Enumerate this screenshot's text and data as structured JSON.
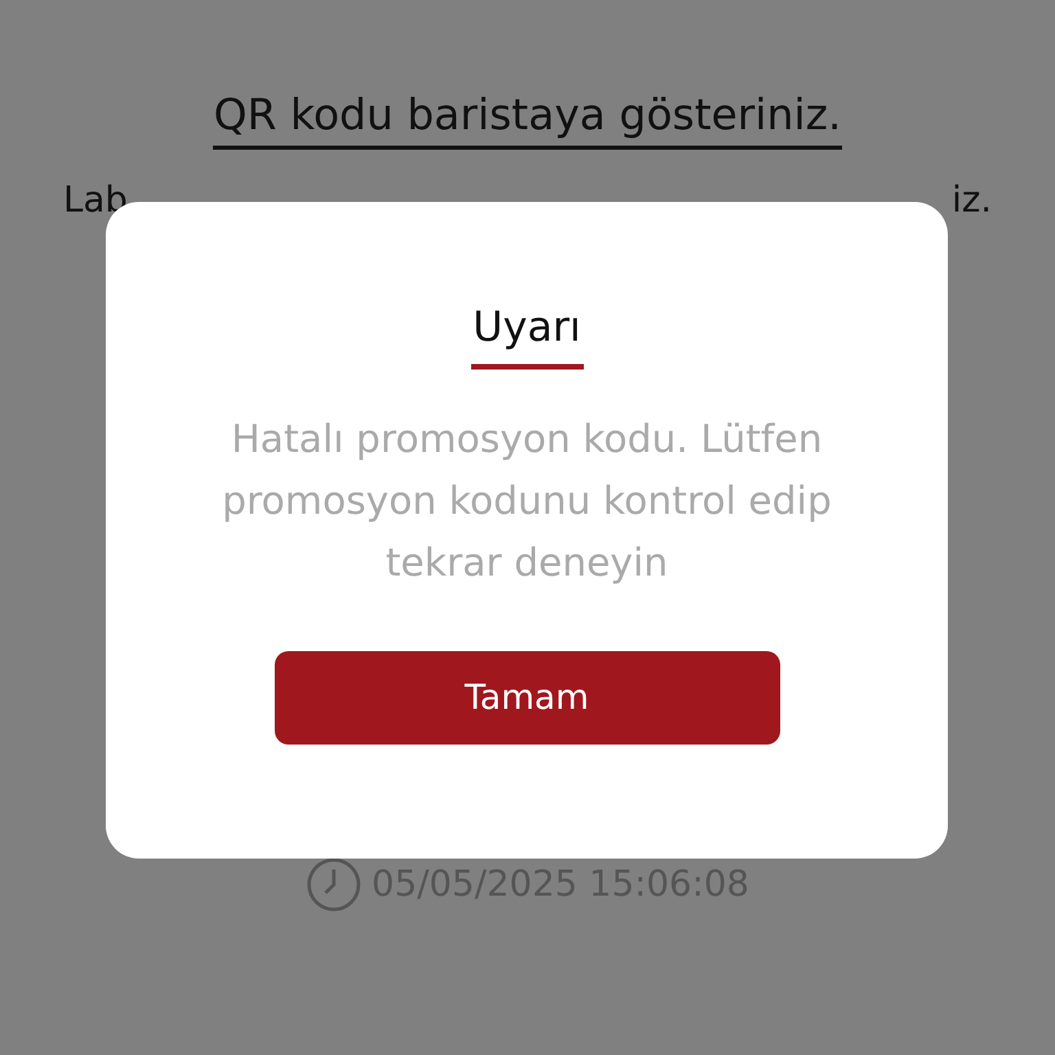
{
  "page": {
    "title": "QR kodu baristaya gösteriniz.",
    "note_left": "Lab",
    "note_right": "iz.",
    "timestamp": "05/05/2025 15:06:08"
  },
  "dialog": {
    "title": "Uyarı",
    "message": "Hatalı promosyon kodu. Lütfen promosyon kodunu kontrol edip tekrar deneyin",
    "button": "Tamam"
  }
}
